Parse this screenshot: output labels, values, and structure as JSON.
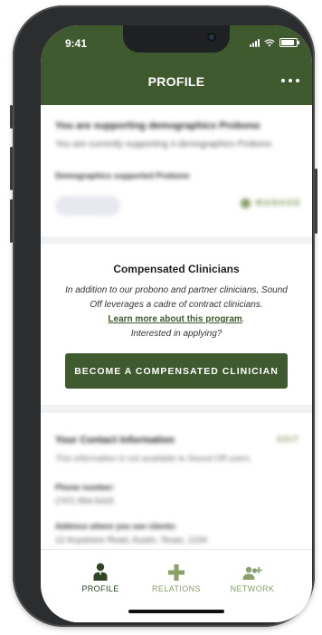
{
  "status_bar": {
    "time": "9:41"
  },
  "header": {
    "title": "PROFILE"
  },
  "support_card": {
    "heading": "You are supporting demographics Probono",
    "subtext": "You are currently supporting 4 demographics Probono",
    "section_label": "Demographics supported Probono",
    "manage_label": "MANAGE"
  },
  "compensated": {
    "heading": "Compensated Clinicians",
    "body_line1": "In addition to our probono and partner clinicians, Sound",
    "body_line2": "Off leverages a cadre of contract clinicians.",
    "link_text": "Learn more about this program",
    "link_suffix": ".",
    "question": "Interested in applying?",
    "button_label": "BECOME A COMPENSATED CLINICIAN"
  },
  "contact": {
    "heading": "Your Contact Information",
    "edit_label": "EDIT",
    "note": "This information is not available to Sound Off users.",
    "phone_label": "Phone number:",
    "phone_value": "(747) 954-5415",
    "address_label": "Address where you see clients:",
    "address_value": "12 Anywhere Road, Austin, Texas, 1234"
  },
  "tabs": [
    {
      "label": "PROFILE",
      "icon": "profile-icon",
      "active": true
    },
    {
      "label": "RELATIONS",
      "icon": "plus-icon",
      "active": false
    },
    {
      "label": "NETWORK",
      "icon": "add-user-icon",
      "active": false
    }
  ],
  "colors": {
    "brand": "#3f5a2f",
    "accent_light": "#8aa06a"
  }
}
